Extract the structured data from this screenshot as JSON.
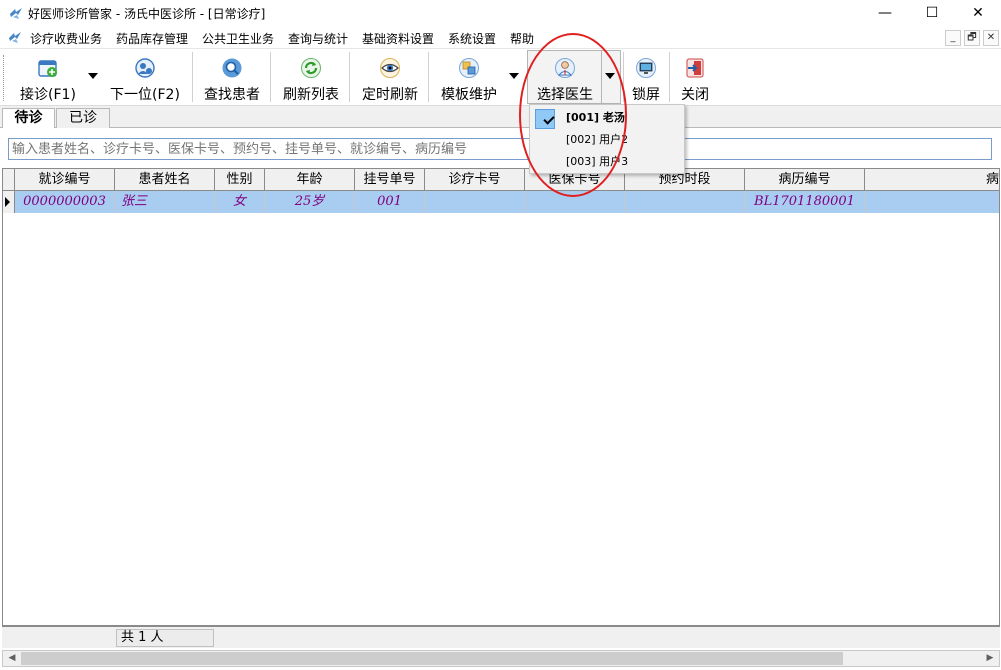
{
  "window": {
    "title": "好医师诊所管家 - 汤氏中医诊所 - [日常诊疗]",
    "minimize": "—",
    "maximize": "☐",
    "close": "✕"
  },
  "menu": {
    "items": [
      "诊疗收费业务",
      "药品库存管理",
      "公共卫生业务",
      "查询与统计",
      "基础资料设置",
      "系统设置",
      "帮助"
    ],
    "mdi_min": "_",
    "mdi_restore": "🗗",
    "mdi_close": "✕"
  },
  "toolbar": {
    "buttons": [
      {
        "label": "接诊(F1)",
        "icon": "calendar-add-icon"
      },
      {
        "label": "下一位(F2)",
        "icon": "user-next-icon"
      },
      {
        "label": "查找患者",
        "icon": "search-icon"
      },
      {
        "label": "刷新列表",
        "icon": "refresh-icon"
      },
      {
        "label": "定时刷新",
        "icon": "eye-icon"
      },
      {
        "label": "模板维护",
        "icon": "template-icon"
      },
      {
        "label": "选择医生",
        "icon": "doctor-icon"
      },
      {
        "label": "锁屏",
        "icon": "monitor-lock-icon"
      },
      {
        "label": "关闭",
        "icon": "exit-icon"
      }
    ]
  },
  "tabs": {
    "waiting": "待诊",
    "done": "已诊"
  },
  "search": {
    "placeholder": "输入患者姓名、诊疗卡号、医保卡号、预约号、挂号单号、就诊编号、病历编号"
  },
  "grid": {
    "columns": [
      "就诊编号",
      "患者姓名",
      "性别",
      "年龄",
      "挂号单号",
      "诊疗卡号",
      "医保卡号",
      "预约时段",
      "病历编号",
      "病"
    ],
    "rows": [
      {
        "visit_no": "0000000003",
        "name": "张三",
        "gender": "女",
        "age": "25岁",
        "reg_no": "001",
        "card_no": "",
        "insurance_no": "",
        "appointment": "",
        "record_no": "BL1701180001",
        "extra": ""
      }
    ]
  },
  "footer": {
    "count_label": "共 1 人"
  },
  "doctor_menu": {
    "items": [
      {
        "label": "[001] 老汤",
        "checked": true
      },
      {
        "label": "[002] 用户2",
        "checked": false
      },
      {
        "label": "[003] 用户3",
        "checked": false
      }
    ]
  },
  "colors": {
    "selected_row": "#a8cdf1",
    "row_text": "#800080",
    "annotation": "#e02020"
  }
}
